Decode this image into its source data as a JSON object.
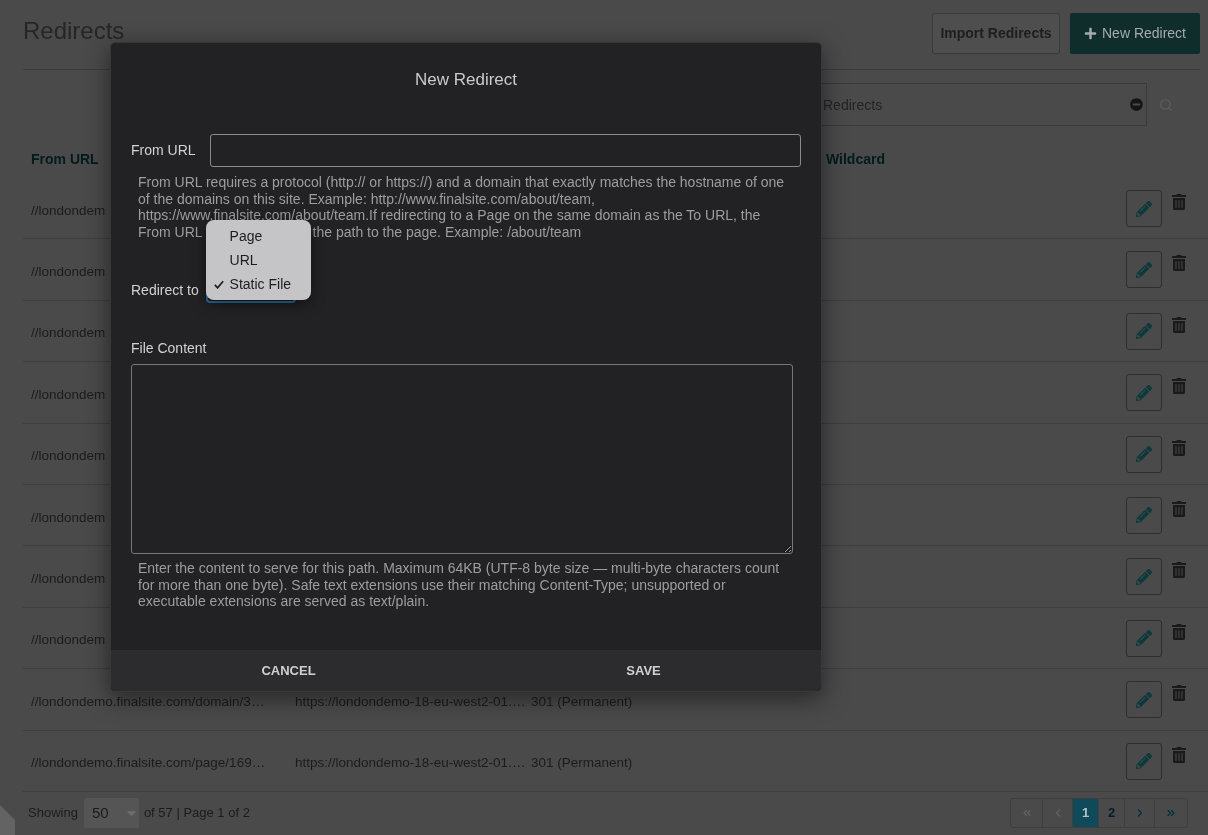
{
  "page": {
    "title": "Redirects",
    "buttons": [
      {
        "label": "Import Redirects",
        "kind": "secondary"
      },
      {
        "label": "New Redirect",
        "kind": "primary"
      }
    ]
  },
  "search": {
    "placeholder": "Redirects"
  },
  "table": {
    "headers": {
      "from_url": "From URL",
      "wildcard": "Wildcard"
    },
    "rows": [
      {
        "from_url": "//londondem"
      },
      {
        "from_url": "//londondem"
      },
      {
        "from_url": "//londondem"
      },
      {
        "from_url": "//londondem"
      },
      {
        "from_url": "//londondem"
      },
      {
        "from_url": "//londondem"
      },
      {
        "from_url": "//londondem"
      },
      {
        "from_url": "//londondem"
      },
      {
        "from_url": "//londondemo.finalsite.com/domain/3…",
        "column_2": "https://londondemo-18-eu-west2-01.…",
        "column_3": "301 (Permanent)"
      },
      {
        "from_url": "//londondemo.finalsite.com/page/169…",
        "column_2": "https://londondemo-18-eu-west2-01.…",
        "column_3": "301 (Permanent)"
      }
    ]
  },
  "footer": {
    "showing": "Showing",
    "page_size": "50",
    "summary": "of 57 | Page 1 of 2",
    "pagination": [
      {
        "kind": "first",
        "disabled": true
      },
      {
        "kind": "prev",
        "disabled": true
      },
      {
        "kind": "page",
        "label": "1",
        "selected": true
      },
      {
        "kind": "page",
        "label": "2",
        "selected": false
      },
      {
        "kind": "next",
        "disabled": false
      },
      {
        "kind": "last",
        "disabled": false
      }
    ]
  },
  "dialog": {
    "title": "New Redirect",
    "from_url": {
      "label": "From URL",
      "help": [
        "From URL requires a protocol (http:// or https://) and a domain that exactly matches the hostname of one of the domains on this site. Example: http://www.finalsite.com/about/team, https://www.finalsite.com/about/team.If redirecting to a Page on the same domain as the To URL, the",
        "From URL",
        "the path to the page. Example: /about/team"
      ]
    },
    "redirect_to": {
      "label": "Redirect to",
      "options": [
        {
          "label": "Page",
          "selected": false
        },
        {
          "label": "URL",
          "selected": false
        },
        {
          "label": "Static File",
          "selected": true
        }
      ]
    },
    "file_content": {
      "label": "File Content",
      "help": "Enter the content to serve for this path. Maximum 64KB (UTF-8 byte size — multi-byte characters count for more than one byte). Safe text extensions use their matching Content-Type; unsupported or executable extensions are served as text/plain."
    },
    "buttons": [
      "CANCEL",
      "SAVE"
    ]
  }
}
